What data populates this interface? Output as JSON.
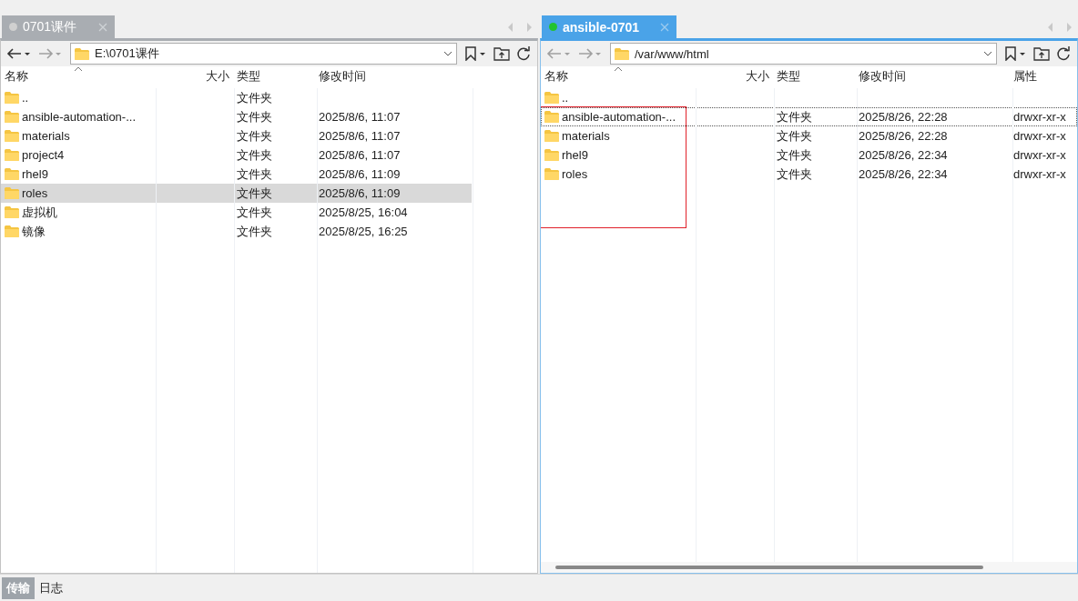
{
  "panes": [
    {
      "tab": {
        "label": "0701课件",
        "selected": false,
        "color": "#d0d0d0"
      },
      "back_disabled": false,
      "forward_disabled": true,
      "path": "E:\\0701课件",
      "columns": [
        "名称",
        "大小",
        "类型",
        "修改时间"
      ],
      "scrollbar": false,
      "annotation": false,
      "rows": [
        {
          "name": "..",
          "type": "文件夹",
          "modified": "",
          "selected": false,
          "focused": false
        },
        {
          "name": "ansible-automation-...",
          "type": "文件夹",
          "modified": "2025/8/6, 11:07",
          "selected": false,
          "focused": false
        },
        {
          "name": "materials",
          "type": "文件夹",
          "modified": "2025/8/6, 11:07",
          "selected": false,
          "focused": false
        },
        {
          "name": "project4",
          "type": "文件夹",
          "modified": "2025/8/6, 11:07",
          "selected": false,
          "focused": false
        },
        {
          "name": "rhel9",
          "type": "文件夹",
          "modified": "2025/8/6, 11:09",
          "selected": false,
          "focused": false
        },
        {
          "name": "roles",
          "type": "文件夹",
          "modified": "2025/8/6, 11:09",
          "selected": true,
          "focused": false
        },
        {
          "name": "虚拟机",
          "type": "文件夹",
          "modified": "2025/8/25, 16:04",
          "selected": false,
          "focused": false
        },
        {
          "name": "镜像",
          "type": "文件夹",
          "modified": "2025/8/25, 16:25",
          "selected": false,
          "focused": false
        }
      ]
    },
    {
      "tab": {
        "label": "ansible-0701",
        "selected": true,
        "color": "#22c32e"
      },
      "back_disabled": true,
      "forward_disabled": true,
      "path": "/var/www/html",
      "columns": [
        "名称",
        "大小",
        "类型",
        "修改时间",
        "属性"
      ],
      "scrollbar": true,
      "annotation": true,
      "rows": [
        {
          "name": "..",
          "type": "",
          "modified": "",
          "attributes": "",
          "selected": false,
          "focused": false
        },
        {
          "name": "ansible-automation-...",
          "type": "文件夹",
          "modified": "2025/8/26, 22:28",
          "attributes": "drwxr-xr-x",
          "selected": false,
          "focused": true
        },
        {
          "name": "materials",
          "type": "文件夹",
          "modified": "2025/8/26, 22:28",
          "attributes": "drwxr-xr-x",
          "selected": false,
          "focused": false
        },
        {
          "name": "rhel9",
          "type": "文件夹",
          "modified": "2025/8/26, 22:34",
          "attributes": "drwxr-xr-x",
          "selected": false,
          "focused": false
        },
        {
          "name": "roles",
          "type": "文件夹",
          "modified": "2025/8/26, 22:34",
          "attributes": "drwxr-xr-x",
          "selected": false,
          "focused": false
        }
      ]
    }
  ],
  "bottom_tabs": [
    {
      "label": "传输",
      "selected": true
    },
    {
      "label": "日志",
      "selected": false
    }
  ]
}
